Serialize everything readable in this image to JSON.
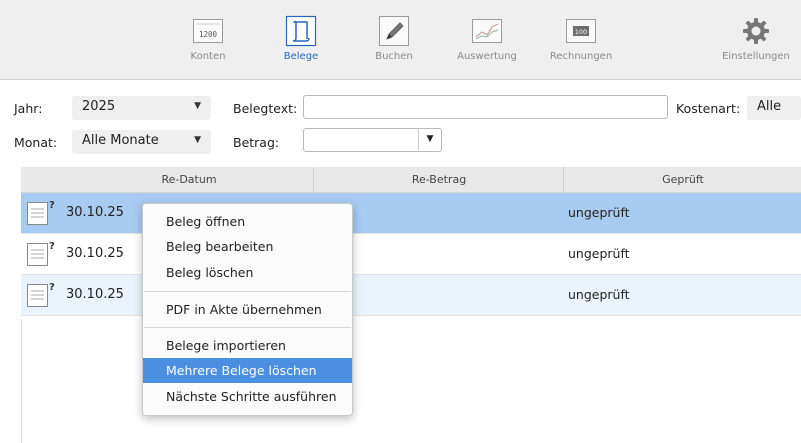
{
  "toolbar": {
    "items": [
      {
        "label": "Konten",
        "icon": "ledger-1200-icon",
        "icon_text": "1200"
      },
      {
        "label": "Belege",
        "icon": "receipt-scroll-icon",
        "active": true
      },
      {
        "label": "Buchen",
        "icon": "pencil-icon"
      },
      {
        "label": "Auswertung",
        "icon": "chart-icon"
      },
      {
        "label": "Rechnungen",
        "icon": "invoice-100-icon",
        "icon_text": "100"
      },
      {
        "label": "Einstellungen",
        "icon": "gear-icon"
      }
    ],
    "accent_color": "#2a66b8"
  },
  "filters": {
    "jahr_label": "Jahr:",
    "jahr_value": "2025",
    "monat_label": "Monat:",
    "monat_value": "Alle Monate",
    "belegtext_label": "Belegtext:",
    "belegtext_value": "",
    "betrag_label": "Betrag:",
    "betrag_value": "",
    "kostenart_label": "Kostenart:",
    "kostenart_value": "Alle"
  },
  "table": {
    "columns": [
      "Re-Datum",
      "Re-Betrag",
      "Geprüft"
    ],
    "rows": [
      {
        "date": "30.10.25",
        "amount": "",
        "status": "ungeprüft",
        "selected": true
      },
      {
        "date": "30.10.25",
        "amount": "",
        "status": "ungeprüft",
        "selected": false
      },
      {
        "date": "30.10.25",
        "amount": "",
        "status": "ungeprüft",
        "selected": false
      }
    ],
    "selected_color": "#a8cbf2",
    "alt_color": "#eaf3fb"
  },
  "context_menu": {
    "items": [
      {
        "label": "Beleg öffnen"
      },
      {
        "label": "Beleg bearbeiten"
      },
      {
        "label": "Beleg löschen"
      },
      {
        "label": "PDF in Akte übernehmen"
      },
      {
        "label": "Belege importieren"
      },
      {
        "label": "Mehrere Belege löschen",
        "highlighted": true
      },
      {
        "label": "Nächste Schritte ausführen"
      }
    ],
    "highlight_color": "#4a8fe0"
  }
}
